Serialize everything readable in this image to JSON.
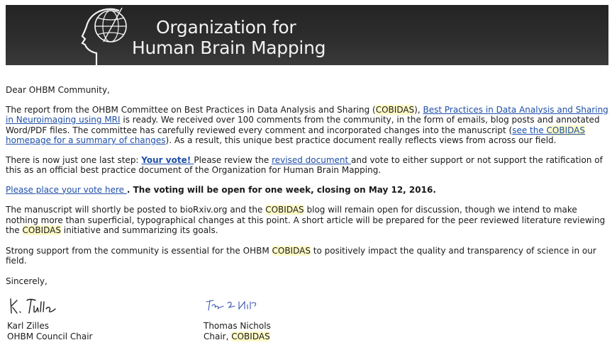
{
  "banner": {
    "title_line1": "Organization for",
    "title_line2": "Human Brain Mapping"
  },
  "letter": {
    "greeting": "Dear OHBM Community,",
    "p1": {
      "t1": "The report from the OHBM Committee on Best Practices in Data Analysis and Sharing (",
      "hl1": "COBIDAS",
      "t2": "), ",
      "link1": "Best Practices in Data Analysis and Sharing in Neuroimaging using MRI",
      "t3": " is ready.  We received over 100 comments from the community, in the form of emails, blog posts and annotated Word/PDF files.  The committee has carefully reviewed every comment and incorporated changes into the manuscript (",
      "link2a": "see the ",
      "link2hl": "COBIDAS",
      "link2b": " homepage for a summary of changes",
      "t4": ").  As a result, this unique best practice document really reflects views from across our field."
    },
    "p2": {
      "t1": "There is now just one last step:  ",
      "vote": "Your vote! ",
      "t2": " Please review the ",
      "revised": "revised document ",
      "t3": "and vote to either support or not support the ratification of this as an official best practice document of the Organization for Human Brain Mapping."
    },
    "p3": {
      "link": "Please place your vote here ",
      "bold": ". The voting will be open for one week, closing on May 12, 2016."
    },
    "p4": {
      "t1": "The manuscript will shortly be posted to bioRxiv.org and the ",
      "hl1": "COBIDAS",
      "t2": " blog will remain open for discussion, though we intend to make nothing more than superficial, typographical changes at this point.  A short article will be prepared for the peer reviewed literature reviewing the ",
      "hl2": "COBIDAS",
      "t3": " initiative and summarizing its goals."
    },
    "p5": {
      "t1": "Strong support from the community is essential for the OHBM ",
      "hl1": "COBIDAS",
      "t2": " to positively impact the quality and transparency of science in our field."
    },
    "closing": "Sincerely,"
  },
  "signatures": {
    "left": {
      "name": "Karl Zilles",
      "role": "OHBM Council Chair"
    },
    "right": {
      "name": "Thomas Nichols",
      "role_prefix": "Chair, ",
      "role_hl": "COBIDAS"
    }
  },
  "colors": {
    "banner_bg": "#2a2a2a",
    "link": "#1f4fa8",
    "highlight": "#fffbc8"
  }
}
